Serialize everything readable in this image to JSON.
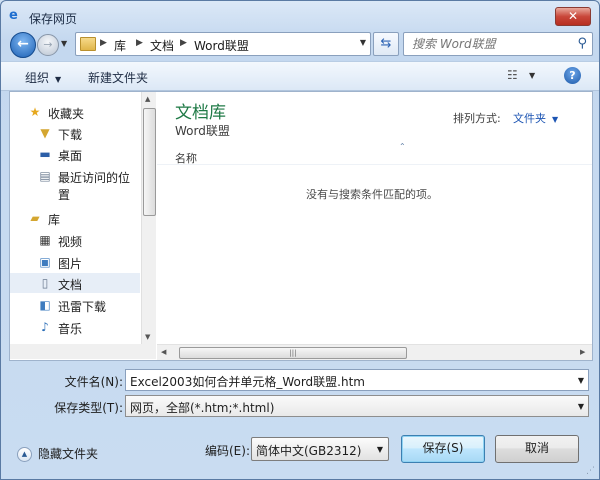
{
  "window": {
    "title": "保存网页",
    "close": "✕"
  },
  "address": {
    "crumbs": [
      "库",
      "文档",
      "Word联盟"
    ],
    "search_placeholder": "搜索 Word联盟"
  },
  "toolbar": {
    "organize": "组织",
    "new_folder": "新建文件夹"
  },
  "nav": {
    "favorites": "收藏夹",
    "downloads": "下载",
    "desktop": "桌面",
    "recent": "最近访问的位置",
    "libraries": "库",
    "videos": "视频",
    "pictures": "图片",
    "documents": "文档",
    "xunlei": "迅雷下载",
    "music": "音乐"
  },
  "content": {
    "library_title": "文档库",
    "library_sub": "Word联盟",
    "sort_label": "排列方式:",
    "sort_value": "文件夹",
    "column_name": "名称",
    "empty_message": "没有与搜索条件匹配的项。"
  },
  "form": {
    "filename_label": "文件名(N):",
    "filename_value": "Excel2003如何合并单元格_Word联盟.htm",
    "type_label": "保存类型(T):",
    "type_value": "网页，全部(*.htm;*.html)",
    "encoding_label": "编码(E):",
    "encoding_value": "简体中文(GB2312)"
  },
  "footer": {
    "hide_folders": "隐藏文件夹",
    "save": "保存(S)",
    "cancel": "取消"
  },
  "colors": {
    "library_title": "#1f7a46",
    "link": "#1d55b3"
  }
}
